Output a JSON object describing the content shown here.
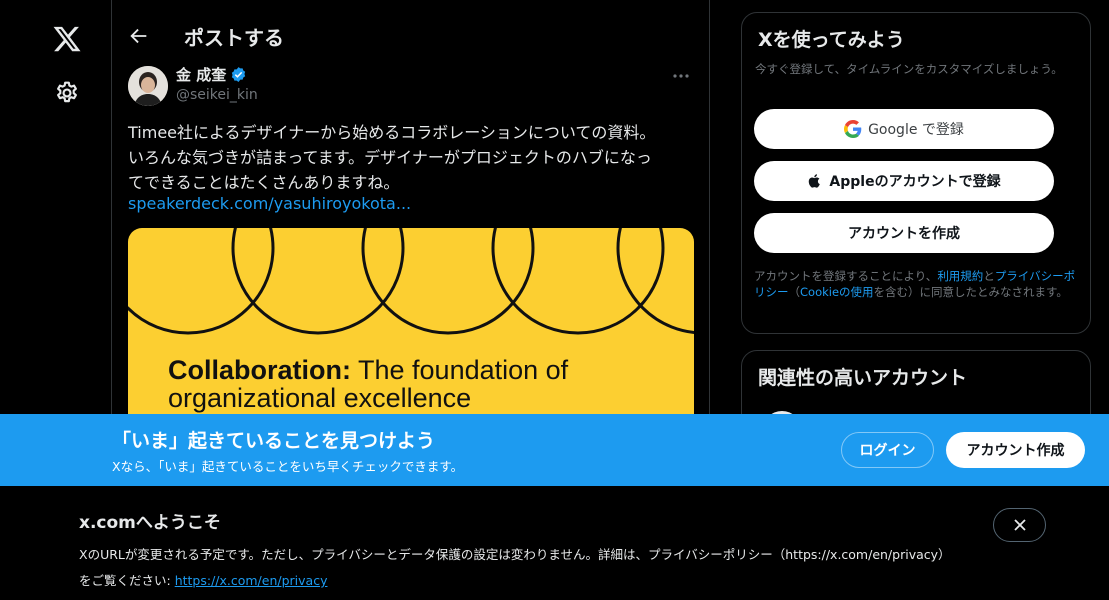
{
  "nav": {
    "logo_icon": "x-logo-icon",
    "settings_icon": "gear-icon"
  },
  "header": {
    "back_icon": "arrow-left-icon",
    "title": "ポストする"
  },
  "tweet": {
    "author_name": "金 成奎",
    "handle": "@seikei_kin",
    "text_lines": [
      "Timee社によるデザイナーから始めるコラボレーションについての資料。",
      "いろんな気づきが詰まってます。デザイナーがプロジェクトのハブになっ",
      "てできることはたくさんありますね。"
    ],
    "link": "speakerdeck.com/yasuhiroyokota...",
    "card": {
      "title_bold": "Collaboration:",
      "title_rest": " The foundation of",
      "title_line2": "organizational excellence",
      "background": "#fccf31"
    }
  },
  "sidebar": {
    "signup": {
      "title": "Xを使ってみよう",
      "subtitle": "今すぐ登録して、タイムラインをカスタマイズしましょう。",
      "google_label": "Google で登録",
      "apple_label": "Appleのアカウントで登録",
      "create_label": "アカウントを作成",
      "terms_pre": "アカウントを登録することにより、",
      "terms_link1": "利用規約",
      "terms_mid1": "と",
      "terms_link2": "プライバシーポリシー",
      "terms_mid2": "（",
      "terms_link3": "Cookieの使用",
      "terms_post": "を含む）に同意したとみなされます。"
    },
    "related": {
      "title": "関連性の高いアカウント"
    }
  },
  "banner": {
    "title": "「いま」起きていることを見つけよう",
    "subtitle": "Xなら、「いま」起きていることをいち早くチェックできます。",
    "login_label": "ログイン",
    "signup_label": "アカウント作成",
    "background": "#1d9bf0"
  },
  "notice": {
    "title": "x.comへようこそ",
    "body": "XのURLが変更される予定です。ただし、プライバシーとデータ保護の設定は変わりません。詳細は、プライバシーポリシー（https://x.com/en/privacy）をご覧ください: ",
    "link": "https://x.com/en/privacy",
    "close_icon": "close-icon"
  },
  "colors": {
    "accent": "#1d9bf0",
    "background": "#000000",
    "text": "#e7e9ea",
    "muted": "#71767b"
  }
}
